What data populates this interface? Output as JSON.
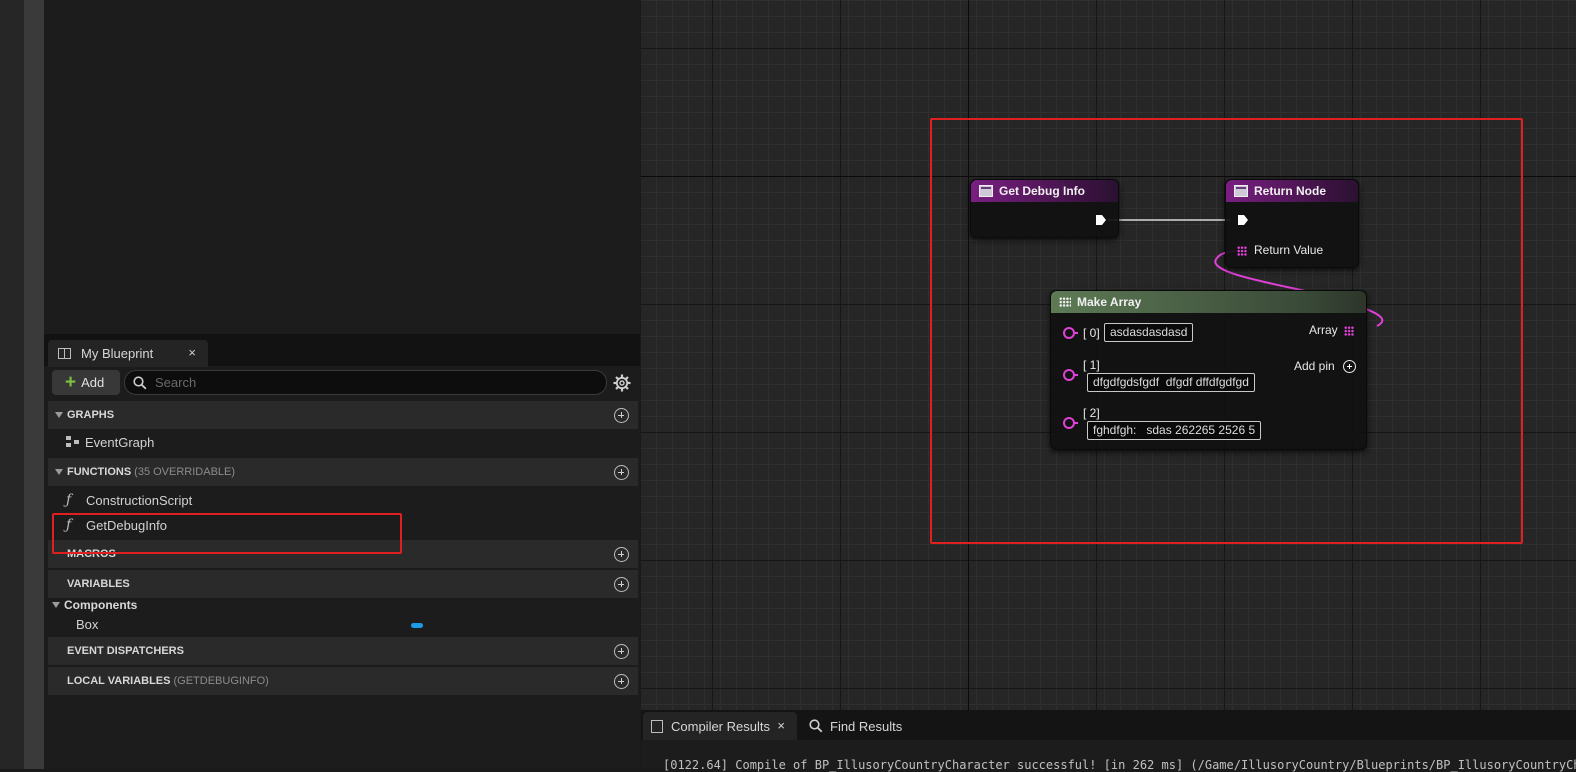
{
  "my_blueprint": {
    "tab_label": "My Blueprint",
    "tab_close": "×",
    "add_label": "Add",
    "search_placeholder": "Search",
    "sections": {
      "graphs": "GRAPHS",
      "functions": "FUNCTIONS",
      "functions_sub": "(35 OVERRIDABLE)",
      "macros": "MACROS",
      "variables": "VARIABLES",
      "event_dispatchers": "EVENT DISPATCHERS",
      "local_variables": "LOCAL VARIABLES",
      "local_variables_sub": "(GETDEBUGINFO)"
    },
    "graphs": [
      "EventGraph"
    ],
    "functions": [
      "ConstructionScript",
      "GetDebugInfo"
    ],
    "components_label": "Components",
    "components": [
      "Box"
    ]
  },
  "graph": {
    "nodes": {
      "get_debug_info": {
        "title": "Get Debug Info"
      },
      "return_node": {
        "title": "Return Node",
        "pin_return_value": "Return Value"
      },
      "make_array": {
        "title": "Make Array",
        "output_label": "Array",
        "add_pin_label": "Add pin",
        "items": [
          {
            "index": "[ 0]",
            "value": "asdasdasdasd"
          },
          {
            "index": "[ 1]",
            "value": "dfgdfgdsfgdf  dfgdf dffdfgdfgd"
          },
          {
            "index": "[ 2]",
            "value": "fghdfgh:   sdas 262265 2526 5"
          }
        ]
      }
    },
    "colors": {
      "array_pin": "#e040d8",
      "highlight": "#e02020",
      "function_header": "#7a1f82",
      "make_array_header": "#5d7a55"
    }
  },
  "bottom": {
    "tab_compiler": "Compiler Results",
    "tab_close": "×",
    "tab_find": "Find Results",
    "log_line": "[0122.64] Compile of BP_IllusoryCountryCharacter successful! [in 262 ms] (/Game/IllusoryCountry/Blueprints/BP_IllusoryCountryCh"
  }
}
